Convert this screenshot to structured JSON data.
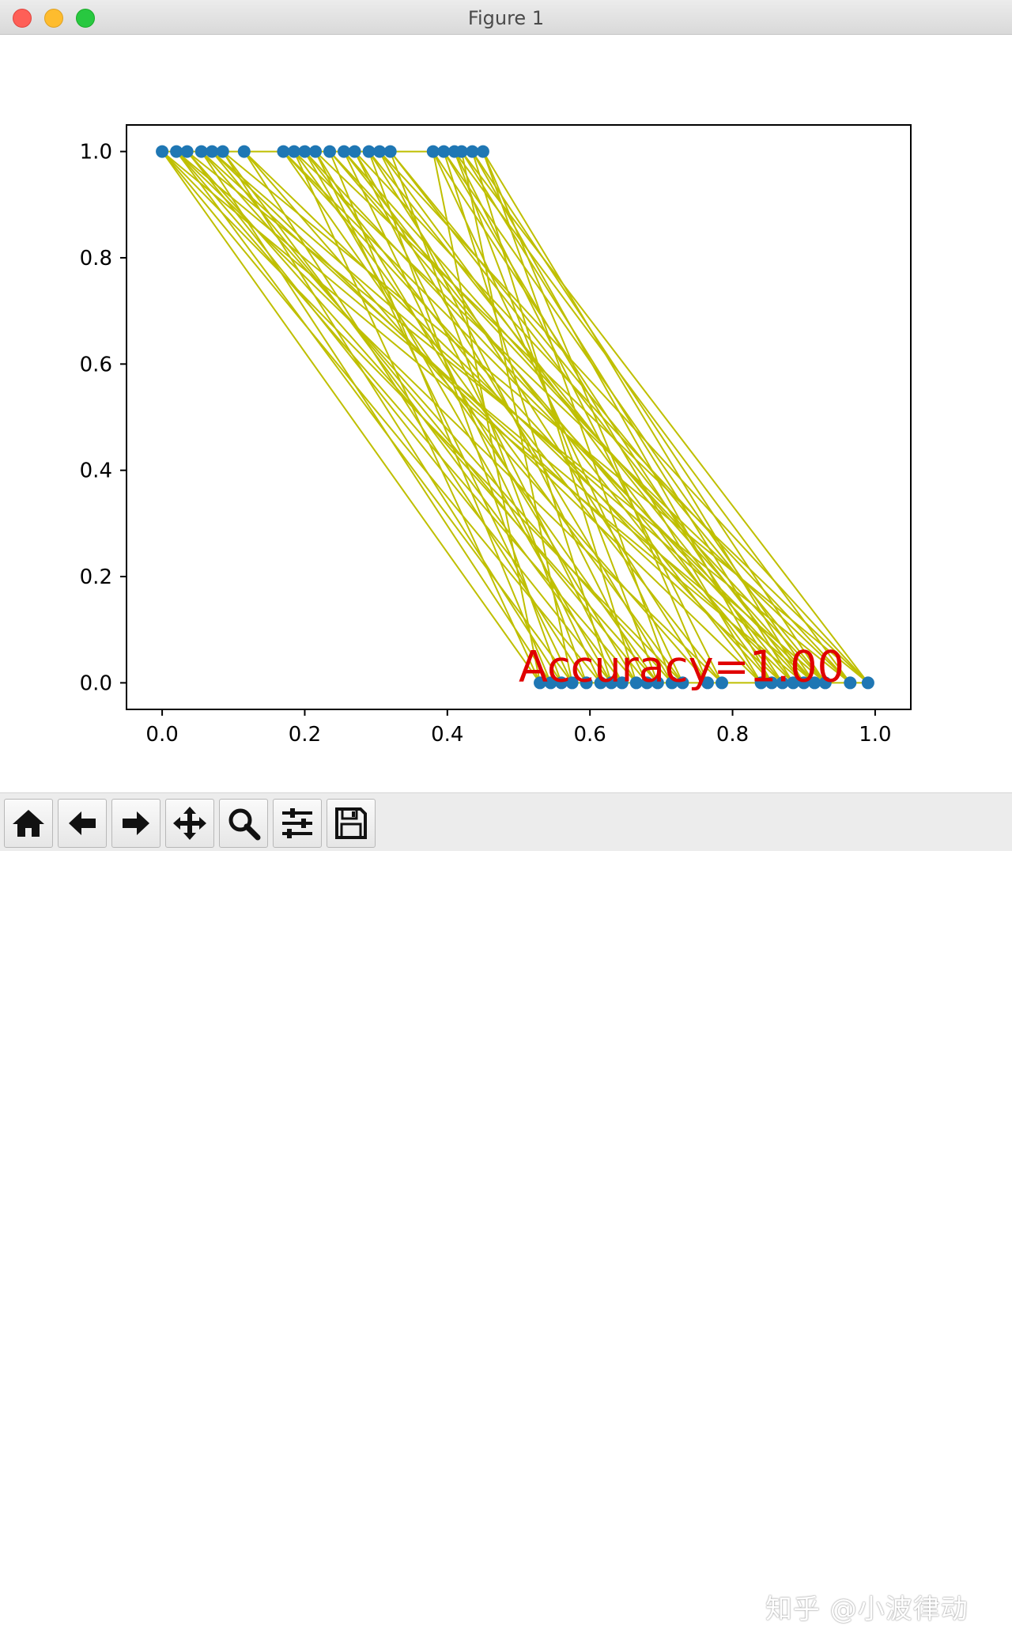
{
  "window": {
    "title": "Figure 1"
  },
  "colors": {
    "points": "#1f77b4",
    "lines": "#bfbf00",
    "annotation": "#e00000"
  },
  "toolbar": {
    "buttons": [
      {
        "name": "home-button",
        "icon": "home-icon"
      },
      {
        "name": "back-button",
        "icon": "arrow-left-icon"
      },
      {
        "name": "forward-button",
        "icon": "arrow-right-icon"
      },
      {
        "name": "pan-button",
        "icon": "move-icon"
      },
      {
        "name": "zoom-button",
        "icon": "magnifier-icon"
      },
      {
        "name": "configure-subplots-button",
        "icon": "sliders-icon"
      },
      {
        "name": "save-button",
        "icon": "floppy-disk-icon"
      }
    ]
  },
  "watermark": "知乎 @小波律动",
  "chart_data": {
    "type": "scatter",
    "title": "",
    "xlabel": "",
    "ylabel": "",
    "xlim": [
      -0.05,
      1.05
    ],
    "ylim": [
      -0.05,
      1.05
    ],
    "x_ticks": [
      0.0,
      0.2,
      0.4,
      0.6,
      0.8,
      1.0
    ],
    "x_tick_labels": [
      "0.0",
      "0.2",
      "0.4",
      "0.6",
      "0.8",
      "1.0"
    ],
    "y_ticks": [
      0.0,
      0.2,
      0.4,
      0.6,
      0.8,
      1.0
    ],
    "y_tick_labels": [
      "0.0",
      "0.2",
      "0.4",
      "0.6",
      "0.8",
      "1.0"
    ],
    "grid": false,
    "annotation": {
      "text": "Accuracy=1.00",
      "x": 0.5,
      "y": 0.0
    },
    "series": [
      {
        "values_x": [
          0.0,
          0.02,
          0.035,
          0.055,
          0.07,
          0.085,
          0.115,
          0.17,
          0.185,
          0.2,
          0.215,
          0.235,
          0.255,
          0.27,
          0.29,
          0.305,
          0.32,
          0.38,
          0.395,
          0.41,
          0.42,
          0.435,
          0.45
        ],
        "values_y": [
          1,
          1,
          1,
          1,
          1,
          1,
          1,
          1,
          1,
          1,
          1,
          1,
          1,
          1,
          1,
          1,
          1,
          1,
          1,
          1,
          1,
          1,
          1
        ]
      },
      {
        "values_x": [
          0.53,
          0.545,
          0.56,
          0.575,
          0.595,
          0.615,
          0.63,
          0.645,
          0.665,
          0.68,
          0.695,
          0.715,
          0.73,
          0.765,
          0.785,
          0.84,
          0.855,
          0.87,
          0.885,
          0.9,
          0.915,
          0.93,
          0.965,
          0.99
        ],
        "values_y": [
          0,
          0,
          0,
          0,
          0,
          0,
          0,
          0,
          0,
          0,
          0,
          0,
          0,
          0,
          0,
          0,
          0,
          0,
          0,
          0,
          0,
          0,
          0,
          0
        ]
      }
    ],
    "links": [
      [
        0,
        12
      ],
      [
        0,
        5
      ],
      [
        0,
        19
      ],
      [
        0,
        0
      ],
      [
        1,
        8
      ],
      [
        1,
        20
      ],
      [
        1,
        3
      ],
      [
        1,
        14
      ],
      [
        2,
        10
      ],
      [
        2,
        22
      ],
      [
        2,
        6
      ],
      [
        3,
        17
      ],
      [
        3,
        1
      ],
      [
        3,
        11
      ],
      [
        4,
        9
      ],
      [
        4,
        21
      ],
      [
        4,
        15
      ],
      [
        5,
        7
      ],
      [
        5,
        23
      ],
      [
        5,
        2
      ],
      [
        6,
        13
      ],
      [
        6,
        18
      ],
      [
        6,
        4
      ],
      [
        7,
        20
      ],
      [
        7,
        10
      ],
      [
        7,
        16
      ],
      [
        8,
        0
      ],
      [
        8,
        22
      ],
      [
        8,
        12
      ],
      [
        9,
        6
      ],
      [
        9,
        19
      ],
      [
        9,
        14
      ],
      [
        10,
        23
      ],
      [
        10,
        3
      ],
      [
        10,
        8
      ],
      [
        11,
        17
      ],
      [
        11,
        21
      ],
      [
        11,
        1
      ],
      [
        12,
        15
      ],
      [
        12,
        5
      ],
      [
        12,
        20
      ],
      [
        13,
        11
      ],
      [
        13,
        22
      ],
      [
        13,
        7
      ],
      [
        14,
        18
      ],
      [
        14,
        2
      ],
      [
        14,
        13
      ],
      [
        15,
        16
      ],
      [
        15,
        23
      ],
      [
        15,
        9
      ],
      [
        16,
        4
      ],
      [
        16,
        21
      ],
      [
        16,
        19
      ],
      [
        17,
        12
      ],
      [
        17,
        0
      ],
      [
        17,
        17
      ],
      [
        18,
        15
      ],
      [
        18,
        20
      ],
      [
        18,
        6
      ],
      [
        19,
        22
      ],
      [
        19,
        10
      ],
      [
        19,
        14
      ],
      [
        20,
        18
      ],
      [
        20,
        3
      ],
      [
        20,
        23
      ],
      [
        21,
        16
      ],
      [
        21,
        8
      ],
      [
        21,
        21
      ],
      [
        22,
        13
      ],
      [
        22,
        19
      ],
      [
        22,
        11
      ]
    ]
  }
}
